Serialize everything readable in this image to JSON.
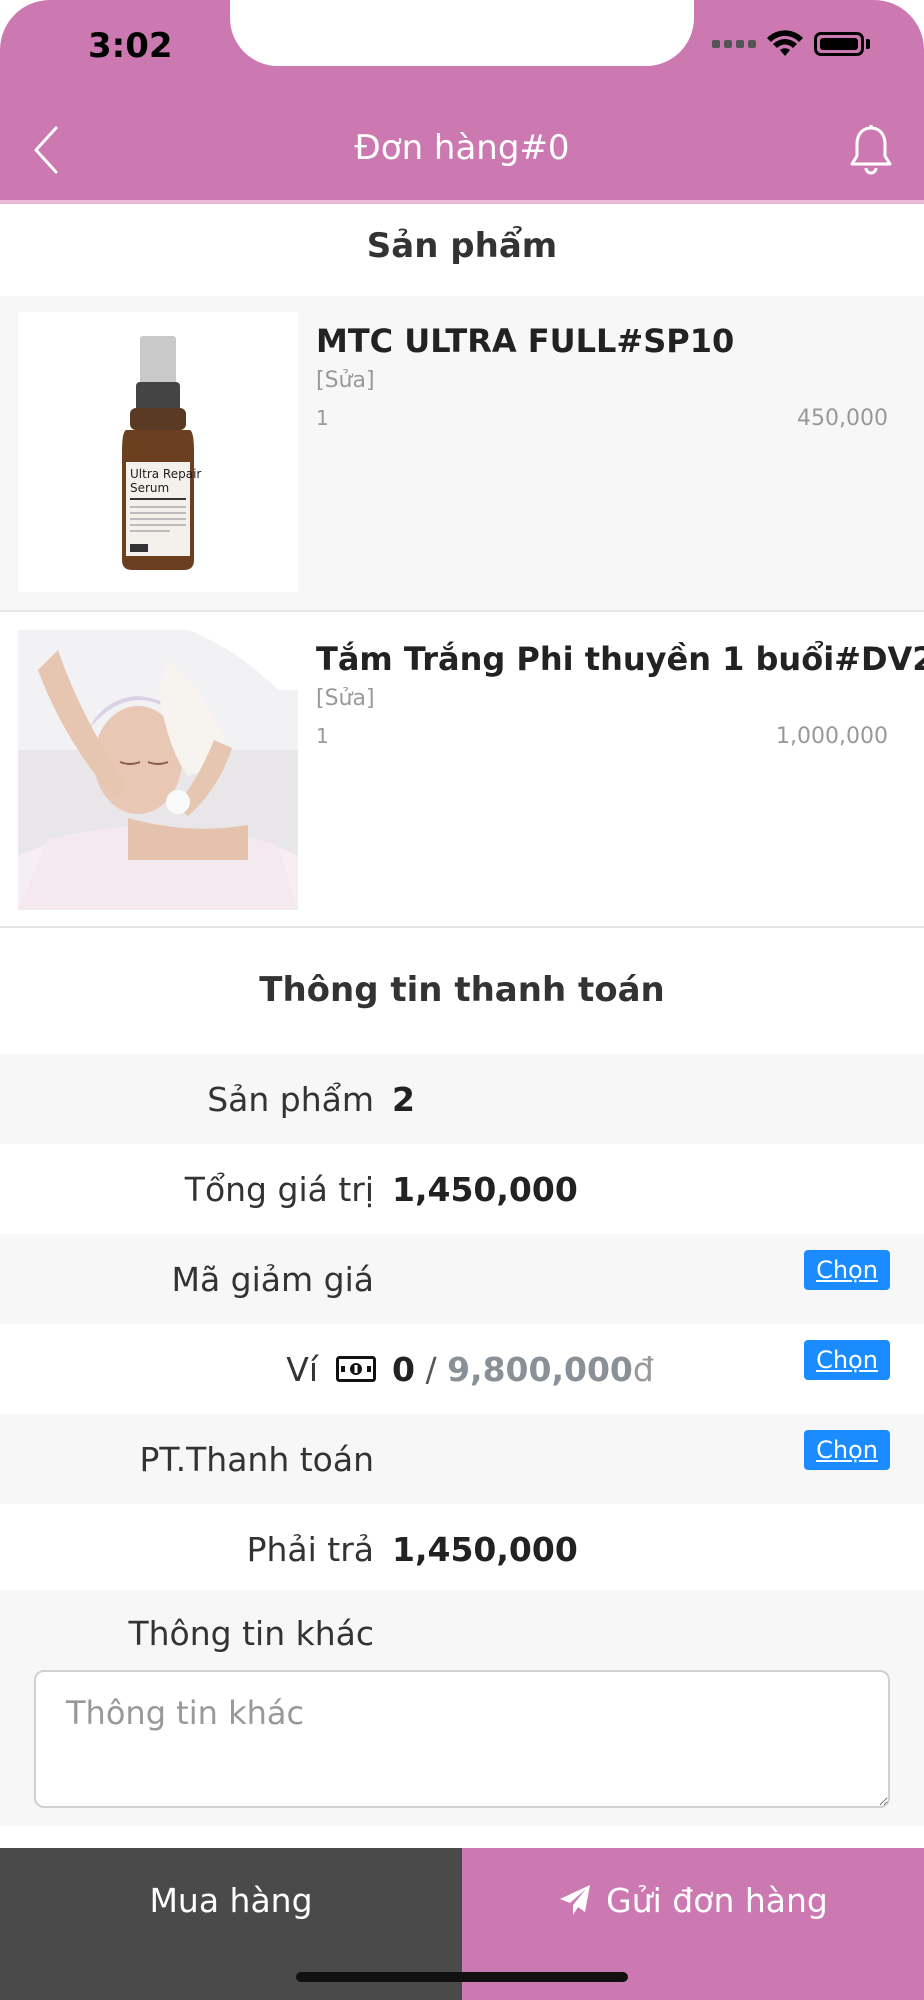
{
  "status_bar": {
    "time": "3:02"
  },
  "nav": {
    "title": "Đơn hàng#0"
  },
  "products_section": {
    "title": "Sản phẩm"
  },
  "products": [
    {
      "name": "MTC ULTRA FULL#SP10",
      "edit": "[Sửa]",
      "qty": "1",
      "price": "450,000",
      "image_label_1": "Ultra Repair",
      "image_label_2": "Serum"
    },
    {
      "name": "Tắm Trắng Phi thuyền 1 buổi#DV2",
      "edit": "[Sửa]",
      "qty": "1",
      "price": "1,000,000"
    }
  ],
  "payment_section": {
    "title": "Thông tin thanh toán"
  },
  "payment": {
    "products_label": "Sản phẩm",
    "products_value": "2",
    "total_label": "Tổng giá trị",
    "total_value": "1,450,000",
    "discount_label": "Mã giảm giá",
    "discount_button": "Chọn",
    "wallet_label": "Ví",
    "wallet_used": "0",
    "wallet_slash": " / ",
    "wallet_total": "9,800,000",
    "wallet_currency": "đ",
    "wallet_button": "Chọn",
    "method_label": "PT.Thanh toán",
    "method_button": "Chọn",
    "pay_label": "Phải trả",
    "pay_value": "1,450,000",
    "other_label": "Thông tin khác",
    "other_placeholder": "Thông tin khác"
  },
  "footer": {
    "buy_label": "Mua hàng",
    "send_label": "Gửi đơn hàng"
  },
  "colors": {
    "header": "#cc79b2",
    "chon_button": "#1a8cff",
    "buy_button": "#4a4a4a",
    "send_button": "#cc79b2"
  }
}
